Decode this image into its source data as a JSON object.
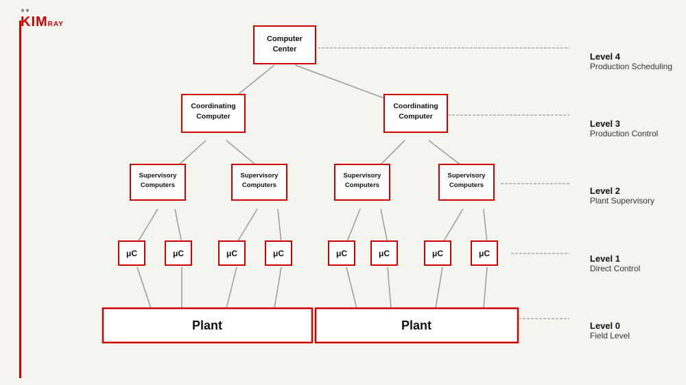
{
  "logo": {
    "text": "KIMRAY",
    "subtitle": ""
  },
  "levels": [
    {
      "id": "level4",
      "title": "Level 4",
      "desc": "Production Scheduling"
    },
    {
      "id": "level3",
      "title": "Level 3",
      "desc": "Production Control"
    },
    {
      "id": "level2",
      "title": "Level 2",
      "desc": "Plant Supervisory"
    },
    {
      "id": "level1",
      "title": "Level 1",
      "desc": "Direct Control"
    },
    {
      "id": "level0",
      "title": "Level 0",
      "desc": "Field Level"
    }
  ],
  "nodes": {
    "computer_center": "Computer Center",
    "coord_left": "Coordinating Computer",
    "coord_right": "Coordinating Computer",
    "sup_ll": "Supervisory Computers",
    "sup_lr": "Supervisory Computers",
    "sup_rl": "Supervisory Computers",
    "sup_rr": "Supervisory Computers",
    "plant_left": "Plant",
    "plant_right": "Plant",
    "uc": "μC"
  }
}
